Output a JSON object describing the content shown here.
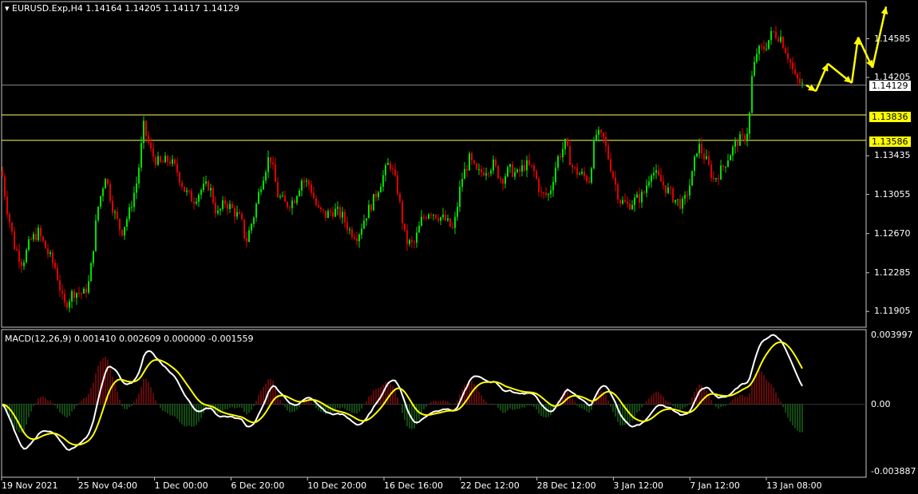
{
  "header": {
    "symbol_line": "EURUSD.Exp,H4  1.14164 1.14205 1.14117 1.14129",
    "macd_line": "MACD(12,26,9) 0.001410 0.002609 0.000000 -0.001559"
  },
  "price_axis": {
    "ticks": [
      "1.14585",
      "1.14205",
      "1.13435",
      "1.13055",
      "1.12670",
      "1.12285",
      "1.11905"
    ],
    "current": "1.14129",
    "levels": [
      "1.13836",
      "1.13586"
    ]
  },
  "macd_axis": {
    "ticks": [
      "0.003997",
      "0.00",
      "-0.003887"
    ]
  },
  "time_axis": {
    "labels": [
      "19 Nov 2021",
      "25 Nov 04:00",
      "1 Dec 00:00",
      "6 Dec 20:00",
      "10 Dec 20:00",
      "16 Dec 16:00",
      "22 Dec 12:00",
      "28 Dec 12:00",
      "3 Jan 12:00",
      "7 Jan 12:00",
      "13 Jan 08:00"
    ]
  },
  "colors": {
    "bull": "#00e000",
    "bear": "#e00000",
    "macd_line": "#ffffff",
    "signal_line": "#ffff00",
    "hist_pos": "#a01010",
    "hist_neg": "#1e7a1e",
    "level": "#ffff66",
    "projection": "#ffff00",
    "frame": "#c8c8c8"
  },
  "chart_data": {
    "type": "candlestick",
    "symbol": "EURUSD.Exp",
    "timeframe": "H4",
    "price_range": [
      1.1175,
      1.1495
    ],
    "close_path": [
      [
        0,
        1.134
      ],
      [
        8,
        1.1295
      ],
      [
        18,
        1.1255
      ],
      [
        28,
        1.1238
      ],
      [
        38,
        1.126
      ],
      [
        48,
        1.1268
      ],
      [
        60,
        1.1248
      ],
      [
        70,
        1.1232
      ],
      [
        80,
        1.1195
      ],
      [
        92,
        1.121
      ],
      [
        105,
        1.1208
      ],
      [
        112,
        1.122
      ],
      [
        122,
        1.129
      ],
      [
        132,
        1.1325
      ],
      [
        142,
        1.129
      ],
      [
        152,
        1.1268
      ],
      [
        162,
        1.1288
      ],
      [
        172,
        1.132
      ],
      [
        180,
        1.1372
      ],
      [
        190,
        1.1345
      ],
      [
        200,
        1.1335
      ],
      [
        212,
        1.134
      ],
      [
        222,
        1.1328
      ],
      [
        232,
        1.1308
      ],
      [
        242,
        1.13
      ],
      [
        252,
        1.131
      ],
      [
        262,
        1.1315
      ],
      [
        272,
        1.1285
      ],
      [
        282,
        1.1298
      ],
      [
        292,
        1.129
      ],
      [
        302,
        1.128
      ],
      [
        308,
        1.1258
      ],
      [
        318,
        1.1285
      ],
      [
        328,
        1.132
      ],
      [
        338,
        1.1345
      ],
      [
        348,
        1.1305
      ],
      [
        358,
        1.1295
      ],
      [
        368,
        1.13
      ],
      [
        378,
        1.132
      ],
      [
        388,
        1.1315
      ],
      [
        398,
        1.129
      ],
      [
        408,
        1.1285
      ],
      [
        418,
        1.129
      ],
      [
        428,
        1.1285
      ],
      [
        438,
        1.127
      ],
      [
        448,
        1.1265
      ],
      [
        458,
        1.1285
      ],
      [
        468,
        1.13
      ],
      [
        478,
        1.132
      ],
      [
        488,
        1.1338
      ],
      [
        498,
        1.131
      ],
      [
        508,
        1.126
      ],
      [
        518,
        1.1255
      ],
      [
        528,
        1.128
      ],
      [
        538,
        1.129
      ],
      [
        548,
        1.1285
      ],
      [
        558,
        1.128
      ],
      [
        568,
        1.127
      ],
      [
        578,
        1.132
      ],
      [
        588,
        1.134
      ],
      [
        598,
        1.1325
      ],
      [
        608,
        1.133
      ],
      [
        618,
        1.1335
      ],
      [
        628,
        1.132
      ],
      [
        638,
        1.133
      ],
      [
        648,
        1.1325
      ],
      [
        658,
        1.1335
      ],
      [
        668,
        1.133
      ],
      [
        678,
        1.1305
      ],
      [
        688,
        1.1305
      ],
      [
        698,
        1.134
      ],
      [
        708,
        1.1355
      ],
      [
        718,
        1.133
      ],
      [
        728,
        1.1325
      ],
      [
        738,
        1.132
      ],
      [
        746,
        1.1365
      ],
      [
        756,
        1.136
      ],
      [
        766,
        1.133
      ],
      [
        776,
        1.13
      ],
      [
        786,
        1.1295
      ],
      [
        796,
        1.13
      ],
      [
        806,
        1.1305
      ],
      [
        816,
        1.133
      ],
      [
        826,
        1.132
      ],
      [
        836,
        1.131
      ],
      [
        846,
        1.13
      ],
      [
        856,
        1.1295
      ],
      [
        866,
        1.132
      ],
      [
        874,
        1.1355
      ],
      [
        884,
        1.134
      ],
      [
        894,
        1.132
      ],
      [
        904,
        1.133
      ],
      [
        914,
        1.1345
      ],
      [
        924,
        1.1358
      ],
      [
        932,
        1.136
      ],
      [
        938,
        1.1372
      ],
      [
        942,
        1.142
      ],
      [
        948,
        1.1445
      ],
      [
        958,
        1.145
      ],
      [
        968,
        1.1465
      ],
      [
        978,
        1.146
      ],
      [
        988,
        1.144
      ],
      [
        996,
        1.142
      ],
      [
        1006,
        1.1412
      ]
    ],
    "projection_path": [
      [
        1010,
        1.14129
      ],
      [
        1022,
        1.1407
      ],
      [
        1037,
        1.1434
      ],
      [
        1067,
        1.1415
      ],
      [
        1075,
        1.146
      ],
      [
        1093,
        1.143
      ],
      [
        1110,
        1.149
      ]
    ],
    "levels": [
      1.13836,
      1.13586
    ],
    "current_price": 1.14129,
    "ohlc_last": {
      "open": 1.14164,
      "high": 1.14205,
      "low": 1.14117,
      "close": 1.14129
    },
    "macd": {
      "params": "12,26,9",
      "range": [
        -0.0042,
        0.0043
      ],
      "main": 0.00141,
      "signal": 0.002609,
      "hist_note": "0.000000 -0.001559"
    }
  }
}
